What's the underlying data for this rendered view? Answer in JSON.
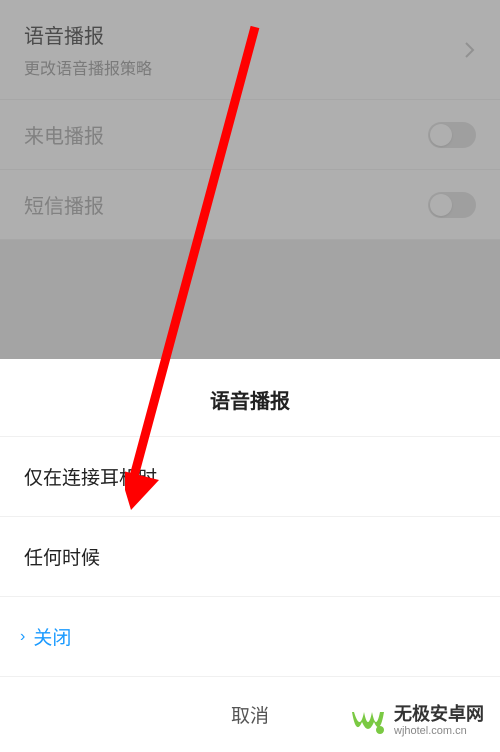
{
  "settings": {
    "voice_broadcast": {
      "title": "语音播报",
      "subtitle": "更改语音播报策略"
    },
    "call_broadcast": {
      "title": "来电播报"
    },
    "sms_broadcast": {
      "title": "短信播报"
    }
  },
  "sheet": {
    "title": "语音播报",
    "option_headphones": "仅在连接耳机时",
    "option_always": "任何时候",
    "option_off": "关闭",
    "cancel": "取消"
  },
  "watermark": {
    "title": "无极安卓网",
    "url": "wjhotel.com.cn"
  },
  "colors": {
    "accent_blue": "#1a9aff",
    "arrow_red": "#ff0000",
    "logo_green": "#7ac943"
  }
}
